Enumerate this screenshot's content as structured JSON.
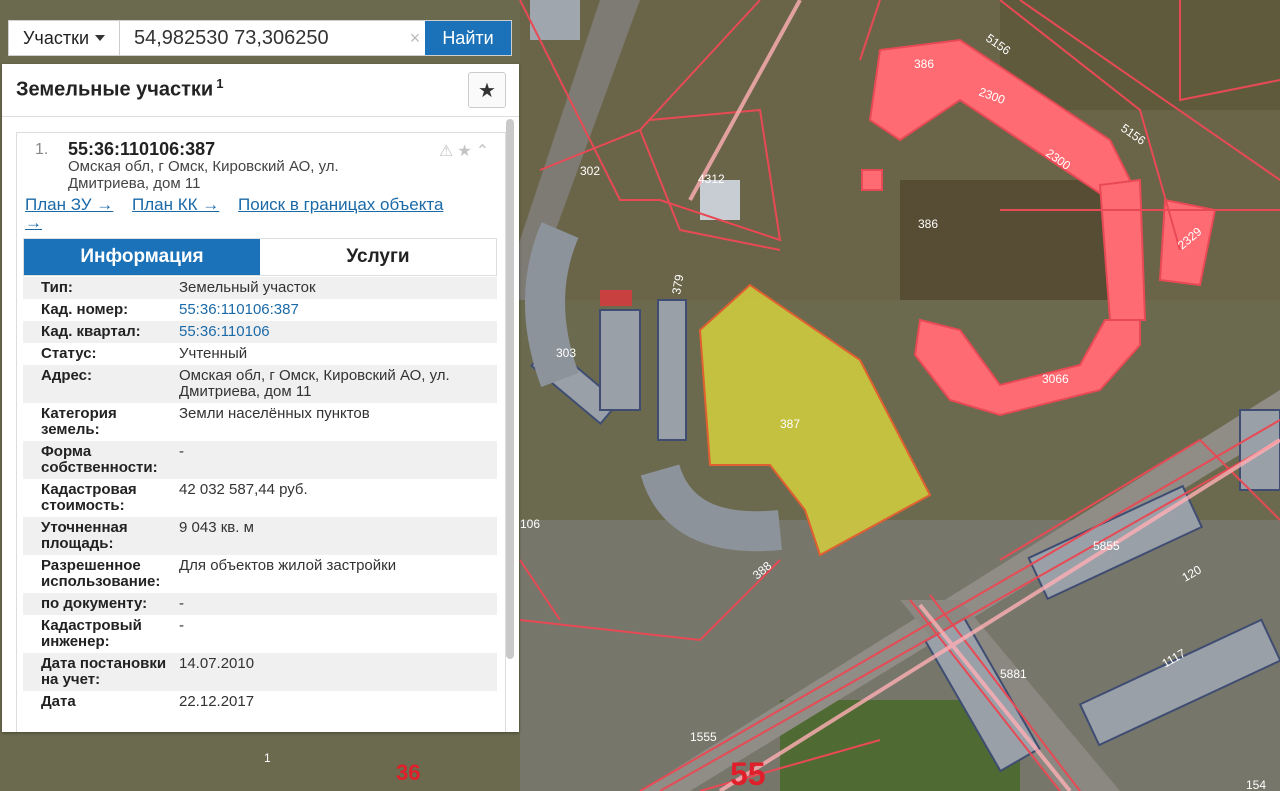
{
  "search": {
    "type_label": "Участки",
    "query": "54,982530 73,306250",
    "clear_icon": "×",
    "find_label": "Найти"
  },
  "panel": {
    "title": "Земельные участки",
    "count": "1",
    "result": {
      "index": "1.",
      "cadastral_number": "55:36:110106:387",
      "address": "Омская обл, г Омск, Кировский АО, ул. Дмитриева, дом 11",
      "links": [
        "План ЗУ →",
        "План КК →",
        "Поиск в границах объекта →"
      ]
    },
    "tabs": [
      {
        "label": "Информация",
        "active": true
      },
      {
        "label": "Услуги",
        "active": false
      }
    ],
    "info_rows": [
      {
        "key": "Тип:",
        "value": "Земельный участок"
      },
      {
        "key": "Кад. номер:",
        "value": "55:36:110106:387",
        "link": true
      },
      {
        "key": "Кад. квартал:",
        "value": "55:36:110106",
        "link": true
      },
      {
        "key": "Статус:",
        "value": "Учтенный"
      },
      {
        "key": "Адрес:",
        "value": "Омская обл, г Омск, Кировский АО, ул. Дмитриева, дом 11"
      },
      {
        "key": "Категория земель:",
        "value": "Земли населённых пунктов"
      },
      {
        "key": "Форма собственности:",
        "value": "-"
      },
      {
        "key": "Кадастровая стоимость:",
        "value": "42 032 587,44 руб."
      },
      {
        "key": "Уточненная площадь:",
        "value": "9 043 кв. м"
      },
      {
        "key": "Разрешенное использование:",
        "value": "Для объектов жилой застройки"
      },
      {
        "key": "по документу:",
        "value": "-"
      },
      {
        "key": "Кадастровый инженер:",
        "value": "-"
      },
      {
        "key": "Дата постановки на учет:",
        "value": "14.07.2010"
      },
      {
        "key": "Дата",
        "value": "22.12.2017"
      }
    ]
  },
  "map": {
    "parcel_labels": [
      "386",
      "2300",
      "2300",
      "5156",
      "5156",
      "2329",
      "386",
      "302",
      "4312",
      "379",
      "387",
      "303",
      "3066",
      "106",
      "388",
      "5855",
      "120",
      "5881",
      "1117",
      "1555",
      "1",
      "36",
      "55",
      "154"
    ],
    "selected_color": "#d4cf3e",
    "building_color": "#ff6b72",
    "border_color": "#e84a55"
  },
  "colors": {
    "accent": "#1b72b8",
    "link": "#1b6aa8"
  }
}
